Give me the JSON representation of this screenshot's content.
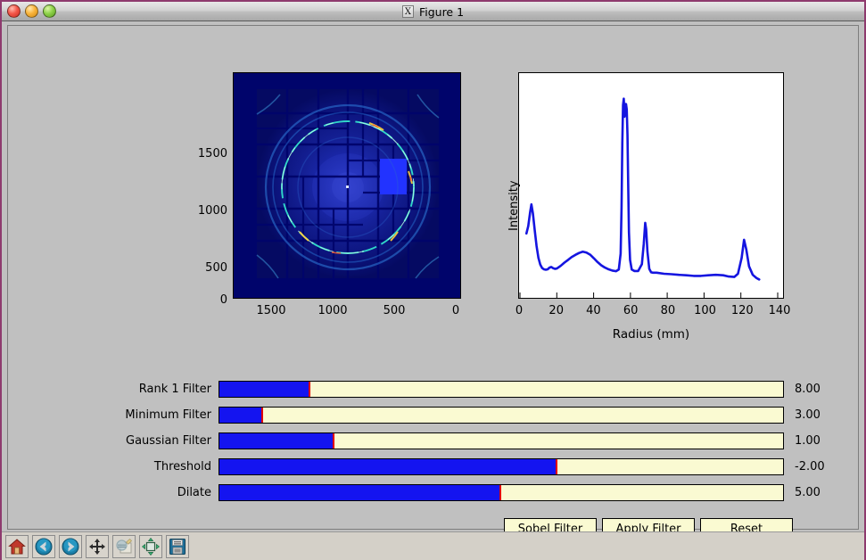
{
  "window": {
    "title": "Figure 1",
    "app_icon": "x-window-icon",
    "traffic_lights": [
      "close-button",
      "minimize-button",
      "zoom-button"
    ]
  },
  "colors": {
    "slider_fill": "#1414F0",
    "slider_track": "#FAFAD2",
    "slider_marker": "#E00000",
    "curve": "#1515E0",
    "figure_bg": "#C0C0C0",
    "detector_bg": "#00007D",
    "button_bg": "#FAFAD2",
    "window_border": "#8E3A6E"
  },
  "detector_plot": {
    "name": "detector-image",
    "xticks": [
      "1500",
      "1000",
      "500",
      "0"
    ],
    "xtick_values": [
      1500,
      1000,
      500,
      0
    ],
    "yticks": [
      "0",
      "500",
      "1000",
      "1500"
    ],
    "ytick_values": [
      0,
      500,
      1000,
      1500
    ],
    "xlim": [
      1900,
      0
    ],
    "ylim": [
      0,
      1900
    ],
    "x_inverted": true,
    "description": "X-ray diffraction detector image, tiled panels, concentric bright rings"
  },
  "chart_data": {
    "type": "line",
    "title": "",
    "xlabel": "Radius (mm)",
    "ylabel": "Intensity",
    "xlim": [
      0,
      140
    ],
    "ylim": [
      0,
      1.0
    ],
    "xticks": [
      0,
      20,
      40,
      60,
      80,
      100,
      120,
      140
    ],
    "xtick_labels": [
      "0",
      "20",
      "40",
      "60",
      "80",
      "100",
      "120",
      "140"
    ],
    "yticks": [],
    "ytick_labels": [],
    "grid": false,
    "legend": false,
    "series": [
      {
        "name": "radial-intensity-profile",
        "color": "#1515E0",
        "x": [
          3.5,
          4.5,
          5.5,
          6.2,
          7.0,
          8.0,
          9.0,
          10.0,
          11.0,
          12.0,
          13.0,
          14.0,
          15.0,
          16.0,
          17.0,
          18.0,
          19.0,
          20.0,
          22.0,
          24.0,
          26.0,
          28.0,
          30.0,
          32.0,
          34.0,
          36.0,
          38.0,
          40.0,
          42.0,
          44.0,
          46.0,
          48.0,
          50.0,
          52.0,
          53.5,
          54.5,
          55.0,
          55.4,
          55.8,
          56.2,
          56.6,
          57.0,
          57.4,
          57.8,
          58.2,
          58.6,
          59.0,
          59.6,
          60.5,
          62.0,
          64.0,
          66.0,
          67.0,
          67.8,
          68.3,
          69.0,
          70.0,
          71.0,
          72.0,
          74.0,
          78.0,
          82.0,
          86.0,
          90.0,
          94.0,
          98.0,
          102.0,
          106.0,
          110.0,
          113.0,
          116.0,
          118.0,
          120.0,
          121.3,
          122.5,
          124.0,
          126.0,
          128.0,
          129.5
        ],
        "y": [
          0.295,
          0.33,
          0.395,
          0.432,
          0.39,
          0.31,
          0.235,
          0.18,
          0.148,
          0.132,
          0.126,
          0.124,
          0.126,
          0.134,
          0.137,
          0.131,
          0.128,
          0.13,
          0.142,
          0.157,
          0.17,
          0.184,
          0.194,
          0.203,
          0.209,
          0.205,
          0.195,
          0.178,
          0.16,
          0.145,
          0.134,
          0.126,
          0.12,
          0.117,
          0.125,
          0.2,
          0.42,
          0.72,
          0.9,
          0.93,
          0.845,
          0.86,
          0.905,
          0.88,
          0.76,
          0.52,
          0.3,
          0.17,
          0.125,
          0.118,
          0.118,
          0.15,
          0.245,
          0.345,
          0.315,
          0.21,
          0.128,
          0.112,
          0.11,
          0.11,
          0.105,
          0.103,
          0.1,
          0.098,
          0.095,
          0.095,
          0.098,
          0.1,
          0.098,
          0.092,
          0.09,
          0.105,
          0.18,
          0.265,
          0.22,
          0.14,
          0.1,
          0.085,
          0.078
        ]
      }
    ],
    "peaks": [
      {
        "radius": 6.2,
        "label": "beam-stop-peak"
      },
      {
        "radius": 34.0,
        "label": "broad-ring"
      },
      {
        "radius": 56.5,
        "label": "main-ring-doublet"
      },
      {
        "radius": 68.0,
        "label": "secondary-ring"
      },
      {
        "radius": 121.5,
        "label": "outer-ring"
      }
    ]
  },
  "sliders": [
    {
      "id": "rank-1-filter",
      "label": "Rank 1 Filter",
      "value": "8.00",
      "fill_pct": 16.0
    },
    {
      "id": "minimum-filter",
      "label": "Minimum Filter",
      "value": "3.00",
      "fill_pct": 7.6
    },
    {
      "id": "gaussian-filter",
      "label": "Gaussian Filter",
      "value": "1.00",
      "fill_pct": 20.3
    },
    {
      "id": "threshold",
      "label": "Threshold",
      "value": "-2.00",
      "fill_pct": 59.8
    },
    {
      "id": "dilate",
      "label": "Dilate",
      "value": "5.00",
      "fill_pct": 49.8
    }
  ],
  "buttons": [
    {
      "id": "sobel-filter",
      "label": "Sobel Filter"
    },
    {
      "id": "apply-filter",
      "label": "Apply Filter"
    },
    {
      "id": "reset",
      "label": "Reset"
    }
  ],
  "toolbar": [
    {
      "id": "home",
      "icon": "home-icon",
      "tooltip": "Home"
    },
    {
      "id": "back",
      "icon": "back-arrow-icon",
      "tooltip": "Back"
    },
    {
      "id": "forward",
      "icon": "forward-arrow-icon",
      "tooltip": "Forward"
    },
    {
      "id": "pan",
      "icon": "pan-move-icon",
      "tooltip": "Pan"
    },
    {
      "id": "zoom",
      "icon": "zoom-rect-icon",
      "tooltip": "Zoom to rectangle"
    },
    {
      "id": "subplots",
      "icon": "configure-subplots-icon",
      "tooltip": "Configure subplots"
    },
    {
      "id": "save",
      "icon": "save-floppy-icon",
      "tooltip": "Save figure"
    }
  ]
}
